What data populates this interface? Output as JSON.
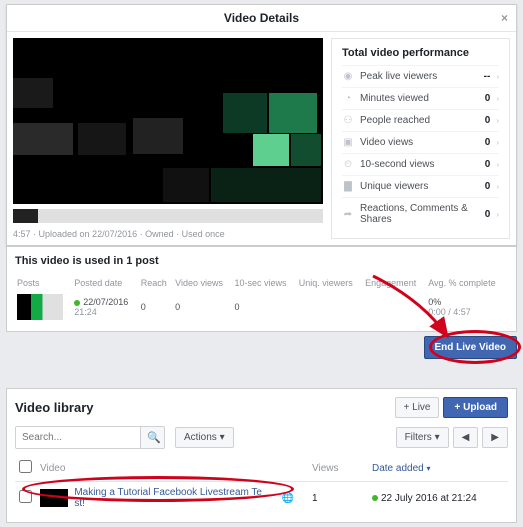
{
  "modal": {
    "title": "Video Details",
    "meta": "4:57 · Uploaded on 22/07/2016 · Owned · Used once"
  },
  "perf": {
    "heading": "Total video performance",
    "rows": [
      {
        "icon": "◉",
        "label": "Peak live viewers",
        "value": "--"
      },
      {
        "icon": "◔",
        "label": "Minutes viewed",
        "value": "0"
      },
      {
        "icon": "⚇",
        "label": "People reached",
        "value": "0"
      },
      {
        "icon": "▣",
        "label": "Video views",
        "value": "0"
      },
      {
        "icon": "⏲",
        "label": "10-second views",
        "value": "0"
      },
      {
        "icon": "▇",
        "label": "Unique viewers",
        "value": "0"
      },
      {
        "icon": "➦",
        "label": "Reactions, Comments & Shares",
        "value": "0"
      }
    ]
  },
  "used": {
    "heading": "This video is used in 1 post",
    "cols": [
      "Posts",
      "Posted date",
      "Reach",
      "Video views",
      "10-sec views",
      "Uniq. viewers",
      "Engagement",
      "Avg. % complete"
    ],
    "row": {
      "date": "22/07/2016",
      "time": "21:24",
      "reach": "0",
      "views": "0",
      "ten": "0",
      "uniq": "",
      "eng": "",
      "avg": "0%",
      "avgsub": "0:00 / 4:57"
    }
  },
  "buttons": {
    "end": "End Live Video",
    "live": "+  Live",
    "upload": "+  Upload",
    "actions": "Actions  ▾",
    "filters": "Filters  ▾"
  },
  "library": {
    "heading": "Video library",
    "search_placeholder": "Search...",
    "cols": {
      "video": "Video",
      "views": "Views",
      "date": "Date added"
    },
    "row": {
      "title": "Making a Tutorial Facebook Livestream Te st!",
      "views": "1",
      "date": "22 July 2016 at 21:24"
    },
    "pager": {
      "prev": "◀",
      "next": "▶"
    }
  }
}
